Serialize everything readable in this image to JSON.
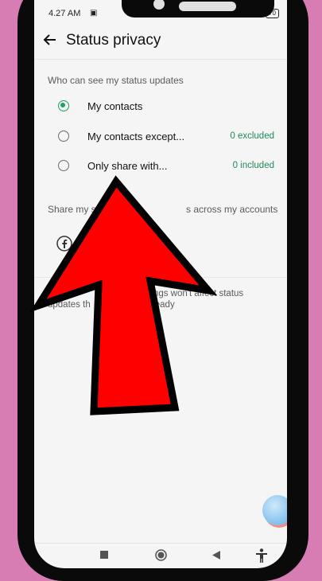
{
  "status_bar": {
    "time": "4.27 AM",
    "battery": "70",
    "icons": [
      "mute-icon",
      "signal-icon",
      "wifi-icon",
      "battery-icon"
    ]
  },
  "app_bar": {
    "title": "Status privacy",
    "back_icon": "back-arrow-icon"
  },
  "visibility_section": {
    "header": "Who can see my status updates",
    "options": [
      {
        "label": "My contacts",
        "meta": "",
        "selected": true
      },
      {
        "label": "My contacts except...",
        "meta": "0 excluded",
        "selected": false
      },
      {
        "label": "Only share with...",
        "meta": "0 included",
        "selected": false
      }
    ]
  },
  "share_section": {
    "header": "Share my s",
    "header_tail": "s across my accounts",
    "account_label": "nt"
  },
  "info_text": {
    "line1a": "o t",
    "line1b": "ttings won't affect status",
    "line2a": "updates th",
    "line2b": "ready"
  },
  "overlay": {
    "arrow_color": "#ff0000",
    "arrow_outline": "#000000"
  },
  "colors": {
    "accent": "#1da160",
    "meta_text": "#1f8a5a",
    "background": "#d77db4"
  },
  "nav_bar": {
    "icons": [
      "recents-square-icon",
      "home-circle-icon",
      "back-triangle-icon",
      "accessibility-icon"
    ]
  }
}
